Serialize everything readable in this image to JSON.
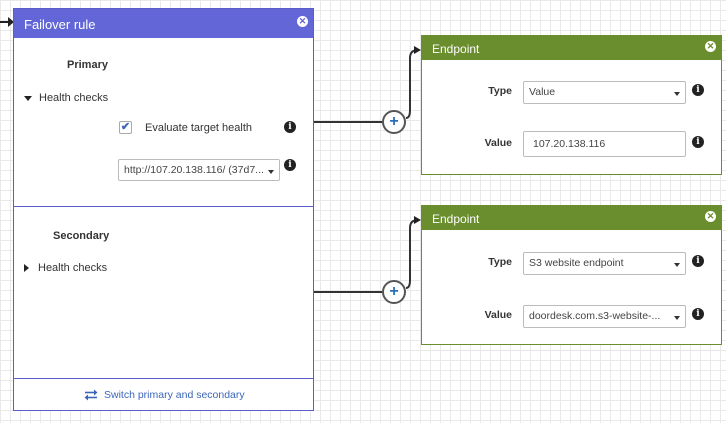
{
  "failover": {
    "title": "Failover rule",
    "primary": {
      "title": "Primary",
      "health_checks_label": "Health checks",
      "evaluate_label": "Evaluate target health",
      "evaluate_checked": true,
      "health_check_select": "http://107.20.138.116/ (37d7..."
    },
    "secondary": {
      "title": "Secondary",
      "health_checks_label": "Health checks"
    },
    "switch_label": "Switch primary and secondary"
  },
  "endpoints": [
    {
      "title": "Endpoint",
      "type_label": "Type",
      "type_value": "Value",
      "value_label": "Value",
      "value_value": "107.20.138.116"
    },
    {
      "title": "Endpoint",
      "type_label": "Type",
      "type_value": "S3 website endpoint",
      "value_label": "Value",
      "value_value": "doordesk.com.s3-website-..."
    }
  ],
  "icons": {
    "close": "close-icon",
    "info": "info-icon",
    "plus": "plus-icon",
    "swap": "swap-icon"
  },
  "colors": {
    "failover_header": "#6266d6",
    "endpoint_header": "#6a8d2e",
    "link": "#3b66b8"
  }
}
